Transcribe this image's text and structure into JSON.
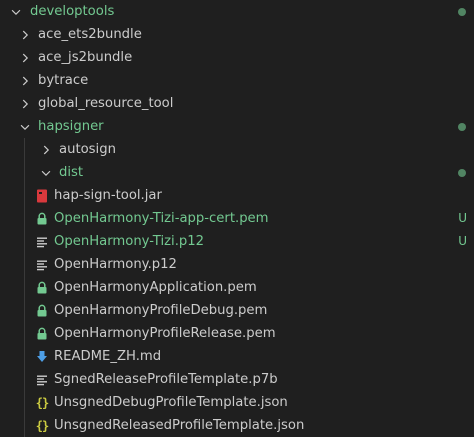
{
  "colors": {
    "background": "#1f1f1f",
    "text": "#cccccc",
    "git_untracked": "#73c991",
    "lock_icon": "#73c991",
    "jar_icon": "#d9393d",
    "readme_icon": "#4d9ee6",
    "json_icon": "#cbcb41"
  },
  "tree": {
    "root": {
      "label": "developtools",
      "expanded": true,
      "git_status_dot": true
    },
    "folders": [
      {
        "label": "ace_ets2bundle",
        "expanded": false
      },
      {
        "label": "ace_js2bundle",
        "expanded": false
      },
      {
        "label": "bytrace",
        "expanded": false
      },
      {
        "label": "global_resource_tool",
        "expanded": false
      }
    ],
    "hapsigner": {
      "label": "hapsigner",
      "expanded": true,
      "git_status_dot": true,
      "autosign": {
        "label": "autosign",
        "expanded": false
      },
      "dist": {
        "label": "dist",
        "expanded": true,
        "git_status_dot": true,
        "files": [
          {
            "label": "hap-sign-tool.jar",
            "icon": "jar-icon",
            "git_status": ""
          },
          {
            "label": "OpenHarmony-Tizi-app-cert.pem",
            "icon": "lock-icon",
            "git_status": "U"
          },
          {
            "label": "OpenHarmony-Tizi.p12",
            "icon": "lines-icon",
            "git_status": "U"
          },
          {
            "label": "OpenHarmony.p12",
            "icon": "lines-icon",
            "git_status": ""
          },
          {
            "label": "OpenHarmonyApplication.pem",
            "icon": "lock-icon",
            "git_status": ""
          },
          {
            "label": "OpenHarmonyProfileDebug.pem",
            "icon": "lock-icon",
            "git_status": ""
          },
          {
            "label": "OpenHarmonyProfileRelease.pem",
            "icon": "lock-icon",
            "git_status": ""
          },
          {
            "label": "README_ZH.md",
            "icon": "download-arrow-icon",
            "git_status": ""
          },
          {
            "label": "SgnedReleaseProfileTemplate.p7b",
            "icon": "lines-icon",
            "git_status": ""
          },
          {
            "label": "UnsgnedDebugProfileTemplate.json",
            "icon": "json-braces-icon",
            "git_status": ""
          },
          {
            "label": "UnsgnedReleasedProfileTemplate.json",
            "icon": "json-braces-icon",
            "git_status": ""
          }
        ]
      }
    }
  }
}
